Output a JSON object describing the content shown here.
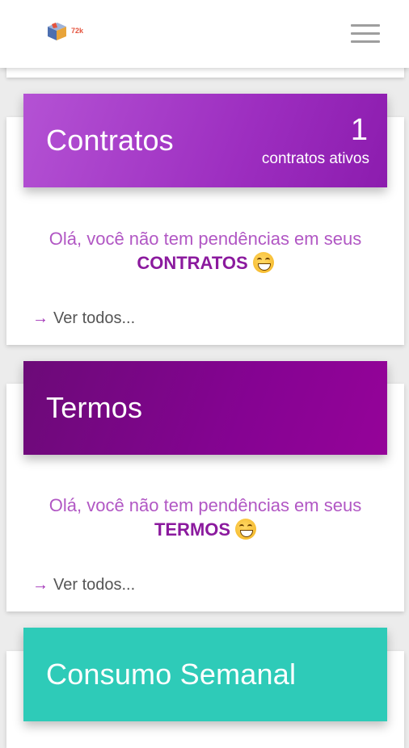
{
  "app": {
    "logo_text": "72k"
  },
  "cards": [
    {
      "title": "Contratos",
      "count": "1",
      "count_label": "contratos ativos",
      "message": "Olá, você não tem pendências em seus",
      "message_strong": "CONTRATOS",
      "link": "Ver todos..."
    },
    {
      "title": "Termos",
      "message": "Olá, você não tem pendências em seus",
      "message_strong": "TERMOS",
      "link": "Ver todos..."
    },
    {
      "title": "Consumo Semanal"
    }
  ],
  "colors": {
    "contratos_header": "#b04fd0",
    "termos_header": "#7a0a86",
    "consumo_header": "#2ecbb8",
    "message_text": "#b157c4",
    "message_strong": "#8b1a9e"
  },
  "icons": {
    "menu": "hamburger-menu-icon",
    "arrow": "arrow-right-icon",
    "emoji": "grinning-face-icon"
  }
}
